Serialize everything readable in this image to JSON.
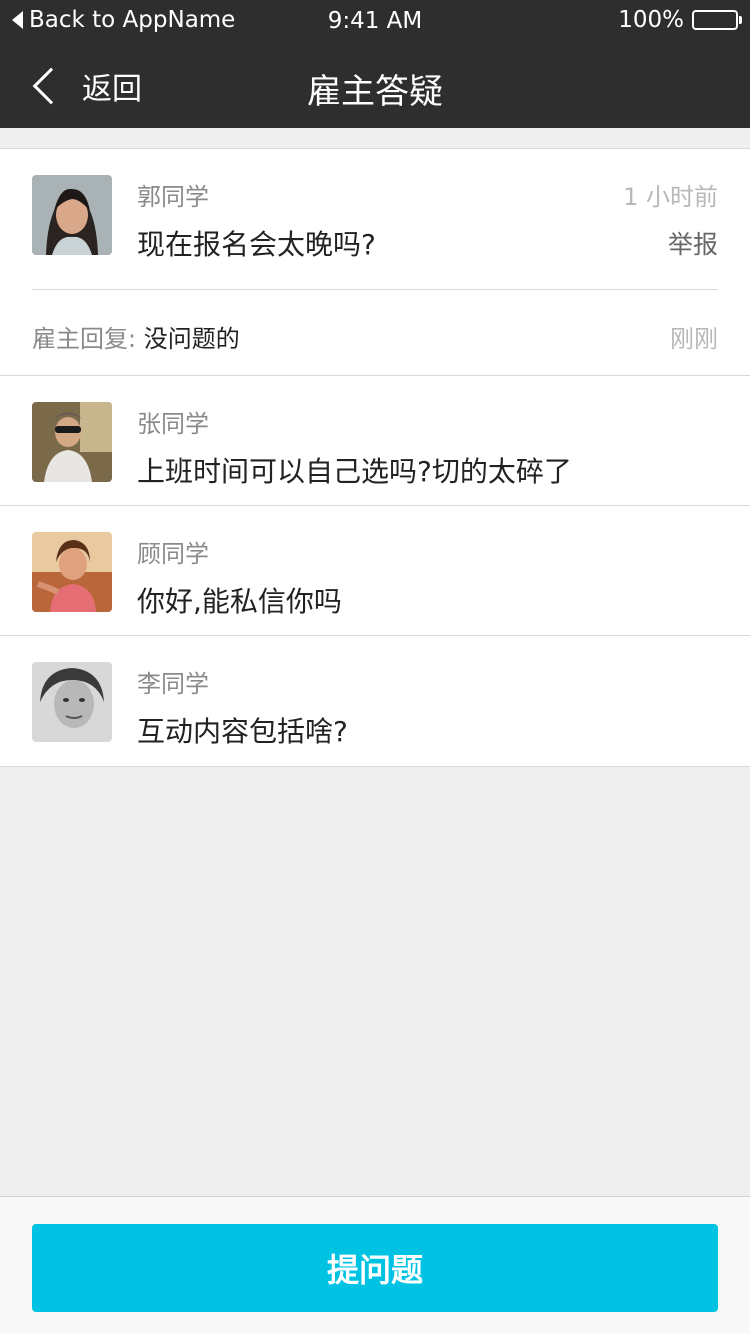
{
  "status_bar": {
    "back_label": "Back to AppName",
    "time": "9:41 AM",
    "battery": "100%"
  },
  "nav": {
    "back_label": "返回",
    "title": "雇主答疑"
  },
  "questions": [
    {
      "name": "郭同学",
      "text": "现在报名会太晚吗?",
      "time": "1 小时前",
      "report": "举报",
      "reply_label": "雇主回复:",
      "reply_text": "没问题的",
      "reply_time": "刚刚"
    },
    {
      "name": "张同学",
      "text": "上班时间可以自己选吗?切的太碎了"
    },
    {
      "name": "顾同学",
      "text": "你好,能私信你吗"
    },
    {
      "name": "李同学",
      "text": "互动内容包括啥?"
    }
  ],
  "bottom": {
    "ask_label": "提问题"
  },
  "colors": {
    "nav_bg": "#2e2e2e",
    "accent": "#00c3e3",
    "page_bg": "#efefef"
  }
}
